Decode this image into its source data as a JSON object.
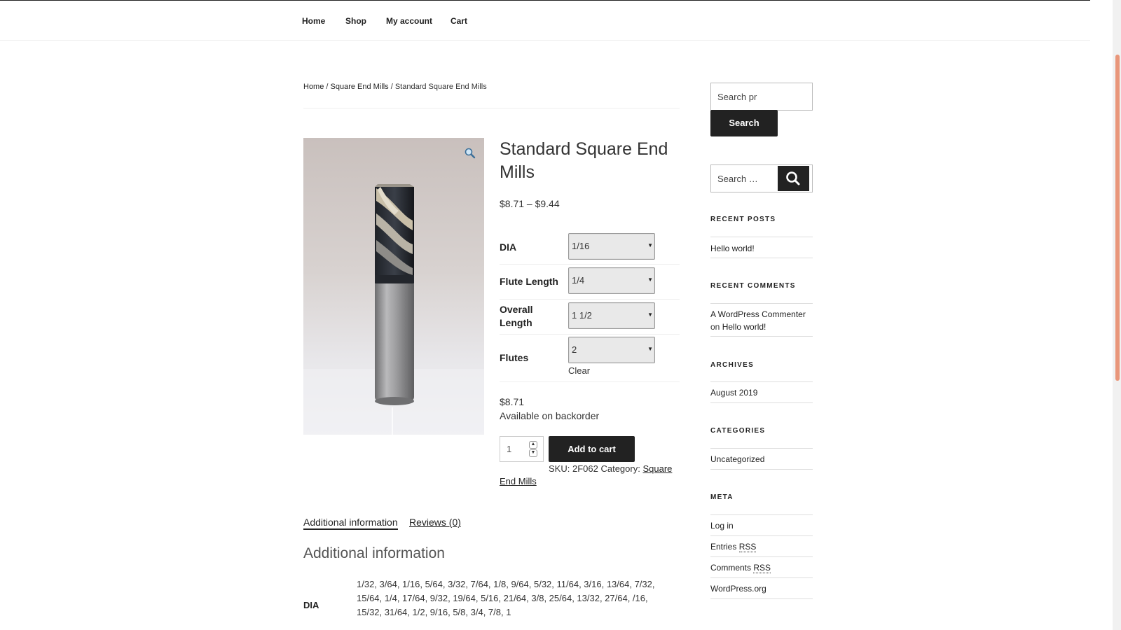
{
  "nav": {
    "home": "Home",
    "shop": "Shop",
    "account": "My account",
    "cart": "Cart"
  },
  "breadcrumb": {
    "home": "Home",
    "sep1": " / ",
    "category": "Square End Mills",
    "sep2": " / ",
    "current": "Standard Square End Mills"
  },
  "product": {
    "title": "Standard Square End Mills",
    "price_range": "$8.71 – $9.44",
    "variations": [
      {
        "label": "DIA",
        "value": "1/16"
      },
      {
        "label": "Flute Length",
        "value": "1/4"
      },
      {
        "label": "Overall Length",
        "value": "1 1/2"
      },
      {
        "label": "Flutes",
        "value": "2"
      }
    ],
    "clear_label": "Clear",
    "variation_price": "$8.71",
    "availability": "Available on backorder",
    "quantity": "1",
    "add_to_cart": "Add to cart",
    "sku_label": "SKU:",
    "sku": "2F062",
    "category_label": "Category:",
    "category_part1": "Square",
    "category_part2": "End Mills"
  },
  "tabs": {
    "additional": "Additional information",
    "reviews": "Reviews (0)"
  },
  "additional_info": {
    "heading": "Additional information",
    "dia_label": "DIA",
    "dia_values": "1/32, 3/64, 1/16, 5/64, 3/32, 7/64, 1/8, 9/64, 5/32, 11/64, 3/16, 13/64, 7/32, 15/64, 1/4, 17/64, 9/32, 19/64, 5/16, 21/64, 3/8, 25/64, 13/32, 27/64, /16, 15/32, 31/64, 1/2, 9/16, 5/8, 3/4, 7/8, 1"
  },
  "sidebar": {
    "search1_placeholder": "Search pr",
    "search1_button": "Search",
    "search2_placeholder": "Search …",
    "recent_posts_title": "RECENT POSTS",
    "recent_post": "Hello world!",
    "recent_comments_title": "RECENT COMMENTS",
    "comment_author": "A WordPress Commenter",
    "comment_on": "on",
    "comment_post": "Hello world!",
    "archives_title": "ARCHIVES",
    "archive": "August 2019",
    "categories_title": "CATEGORIES",
    "category": "Uncategorized",
    "meta_title": "META",
    "meta_login": "Log in",
    "meta_entries": "Entries",
    "meta_comments": "Comments",
    "meta_rss": "RSS",
    "meta_wp": "WordPress.org"
  },
  "icons": {
    "zoom": "magnifier-icon",
    "search": "search-icon"
  },
  "colors": {
    "button": "#222222",
    "scroll_accent": "#e9967a"
  }
}
